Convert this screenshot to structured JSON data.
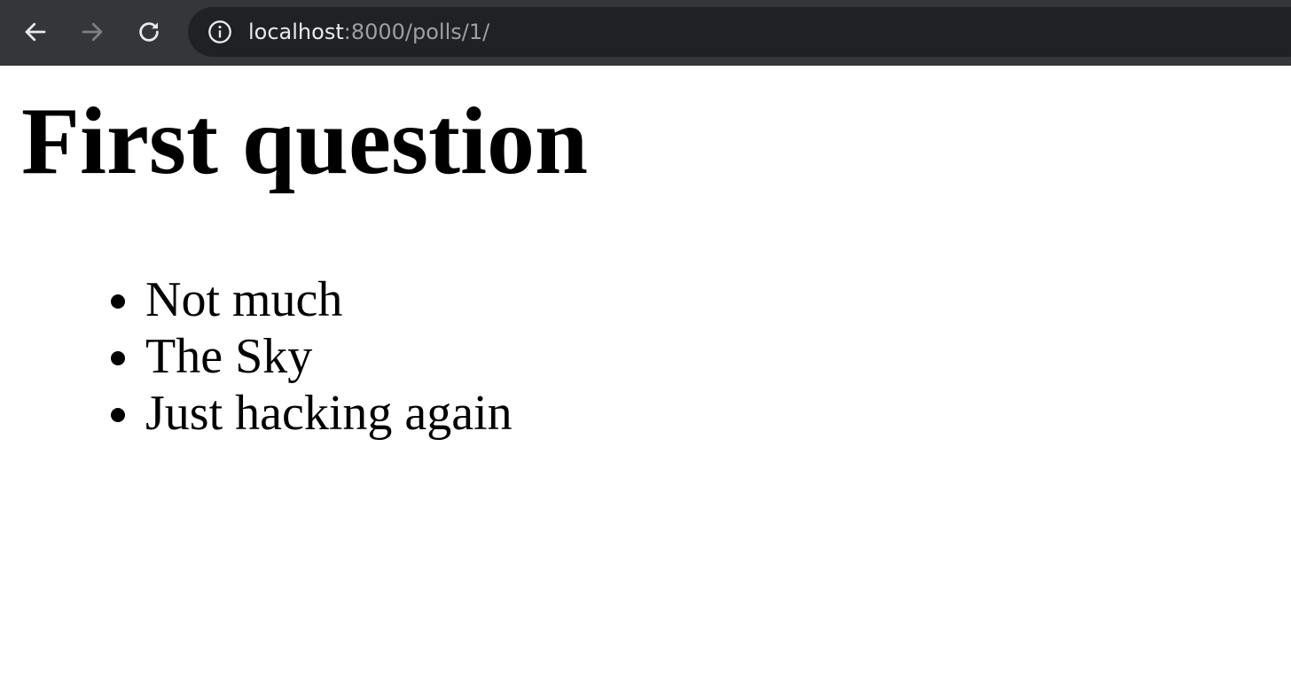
{
  "browser": {
    "url_host": "localhost",
    "url_path": ":8000/polls/1/",
    "icons": {
      "back": "arrow-left-icon",
      "forward": "arrow-right-icon",
      "reload": "reload-icon",
      "site_info": "info-icon"
    },
    "colors": {
      "toolbar_bg": "#35363a",
      "omnibox_bg": "#202124",
      "host_text": "#e8eaed",
      "path_text": "#9aa0a6"
    }
  },
  "page": {
    "title": "First question",
    "choices": [
      "Not much",
      "The Sky",
      "Just hacking again"
    ]
  }
}
